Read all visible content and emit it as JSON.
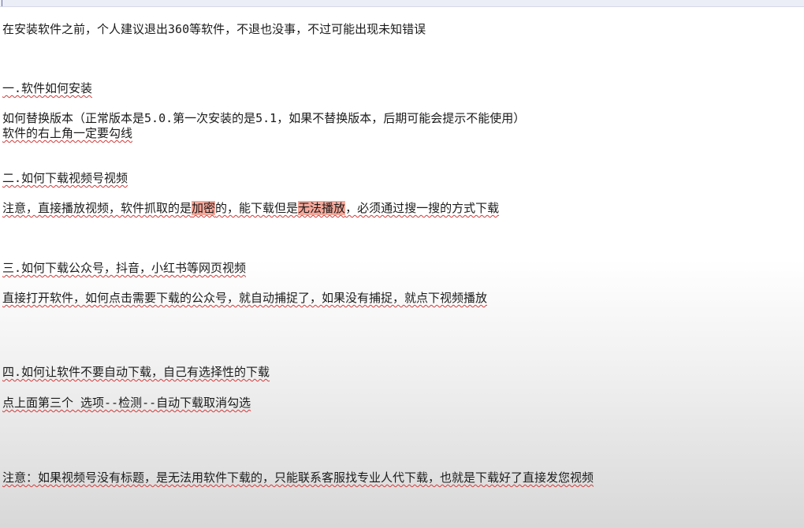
{
  "document": {
    "lines": [
      {
        "id": "intro",
        "text": "在安装软件之前，个人建议退出360等软件，不退也没事，不过可能出现未知错误"
      },
      {
        "id": "h1",
        "text": "一.软件如何安装"
      },
      {
        "id": "p1a",
        "text": "如何替换版本（正常版本是5.0.第一次安装的是5.1，如果不替换版本，后期可能会提示不能使用）"
      },
      {
        "id": "p1b",
        "text": "软件的右上角一定要勾线"
      },
      {
        "id": "h2",
        "text": "二.如何下载视频号视频"
      },
      {
        "id": "p2",
        "segments": [
          "注意，直接播放视频，软件抓取的是",
          "加密",
          "的，能下载但是",
          "无法播放",
          "，必须通过搜一搜的方式下载"
        ]
      },
      {
        "id": "h3",
        "text": "三.如何下载公众号，抖音，小红书等网页视频"
      },
      {
        "id": "p3",
        "text": "直接打开软件，如何点击需要下载的公众号，就自动捕捉了，如果没有捕捉，就点下视频播放"
      },
      {
        "id": "h4",
        "text": "四.如何让软件不要自动下载，自己有选择性的下载"
      },
      {
        "id": "p4",
        "text": "点上面第三个 选项--检测--自动下载取消勾选"
      },
      {
        "id": "p5",
        "text": "注意：如果视频号没有标题，是无法用软件下载的，只能联系客服找专业人代下载，也就是下载好了直接发您视频"
      }
    ]
  },
  "colors": {
    "highlight": "#f6a89a",
    "squiggle": "#d23a3a",
    "text": "#1a1a1a"
  }
}
